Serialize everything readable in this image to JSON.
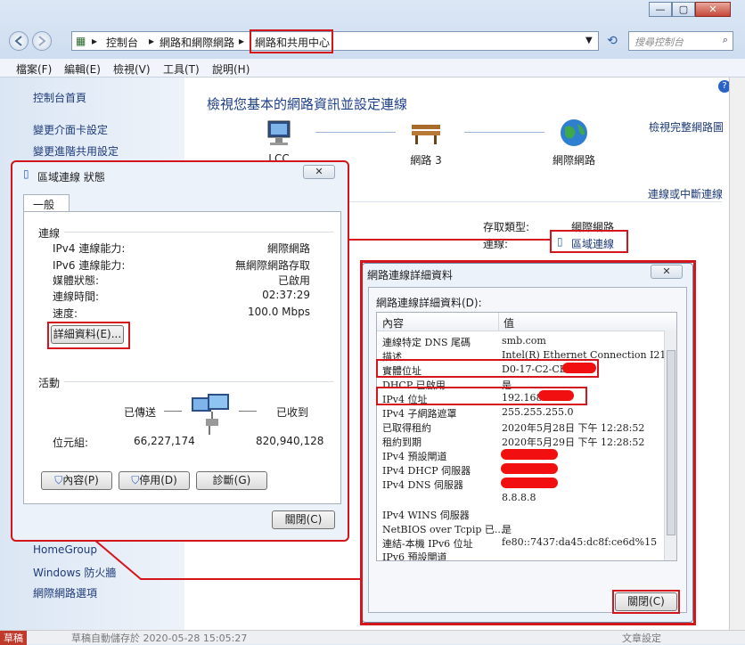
{
  "window": {
    "caption_buttons": {
      "minimize": "—",
      "maximize": "▢",
      "close": "✕"
    },
    "address": {
      "crumbs": [
        "控制台",
        "網路和網際網路",
        "網路和共用中心"
      ],
      "separator": "▸"
    },
    "search_placeholder": "搜尋控制台",
    "menu": [
      "檔案(F)",
      "編輯(E)",
      "檢視(V)",
      "工具(T)",
      "說明(H)"
    ]
  },
  "left_pane": {
    "links": [
      "控制台首頁",
      "變更介面卡設定",
      "變更進階共用設定"
    ],
    "see_also": [
      "HomeGroup",
      "Windows 防火牆",
      "網際網路選項"
    ]
  },
  "main": {
    "title": "檢視您基本的網路資訊並設定連線",
    "view_full_map": "檢視完整網路圖",
    "connect_disconnect": "連線或中斷連線",
    "nodes": [
      {
        "label": "LCC"
      },
      {
        "label": "網路 3"
      },
      {
        "label": "網際網路"
      }
    ],
    "access_type_label": "存取類型:",
    "access_type_value": "網際網路",
    "connections_label": "連線:",
    "connections_value": "區域連線"
  },
  "status_dialog": {
    "title": "區域連線 狀態",
    "tab": "一般",
    "connection_section": "連線",
    "rows": [
      {
        "label": "IPv4 連線能力:",
        "value": "網際網路"
      },
      {
        "label": "IPv6 連線能力:",
        "value": "無網際網路存取"
      },
      {
        "label": "媒體狀態:",
        "value": "已啟用"
      },
      {
        "label": "連線時間:",
        "value": "02:37:29"
      },
      {
        "label": "速度:",
        "value": "100.0 Mbps"
      }
    ],
    "details_button": "詳細資料(E)...",
    "activity_section": "活動",
    "sent_label": "已傳送",
    "received_label": "已收到",
    "bytes_label": "位元組:",
    "bytes_sent": "66,227,174",
    "bytes_received": "820,940,128",
    "buttons": [
      "內容(P)",
      "停用(D)",
      "診斷(G)"
    ],
    "close_button": "關閉(C)"
  },
  "details_dialog": {
    "title": "網路連線詳細資料",
    "subtitle": "網路連線詳細資料(D):",
    "col_property": "內容",
    "col_value": "值",
    "rows": [
      {
        "k": "連線特定 DNS 尾碼",
        "v": "smb.com"
      },
      {
        "k": "描述",
        "v": "Intel(R) Ethernet Connection I217-V"
      },
      {
        "k": "實體位址",
        "v": "D0-17-C2-CB"
      },
      {
        "k": "DHCP 已啟用",
        "v": "是"
      },
      {
        "k": "IPv4 位址",
        "v": "192.168."
      },
      {
        "k": "IPv4 子網路遮罩",
        "v": "255.255.255.0"
      },
      {
        "k": "已取得租約",
        "v": "2020年5月28日 下午 12:28:52"
      },
      {
        "k": "租約到期",
        "v": "2020年5月29日 下午 12:28:52"
      },
      {
        "k": "IPv4 預設閘道",
        "v": ""
      },
      {
        "k": "IPv4 DHCP 伺服器",
        "v": ""
      },
      {
        "k": "IPv4 DNS 伺服器",
        "v": ""
      },
      {
        "k": "",
        "v": "8.8.8.8"
      },
      {
        "k": "IPv4 WINS 伺服器",
        "v": ""
      },
      {
        "k": "NetBIOS over Tcpip 已...",
        "v": "是"
      },
      {
        "k": "連結-本機 IPv6 位址",
        "v": "fe80::7437:da45:dc8f:ce6d%15"
      },
      {
        "k": "IPv6 預設閘道",
        "v": ""
      }
    ],
    "close_button": "關閉(C)"
  },
  "bottom_bar": {
    "left": "草稿",
    "draft_text": "草稿自動儲存於 2020-05-28 15:05:27",
    "right": "文章設定"
  },
  "colors": {
    "highlight": "#d4151b",
    "link": "#1e3a78",
    "title": "#1e3f8a"
  }
}
